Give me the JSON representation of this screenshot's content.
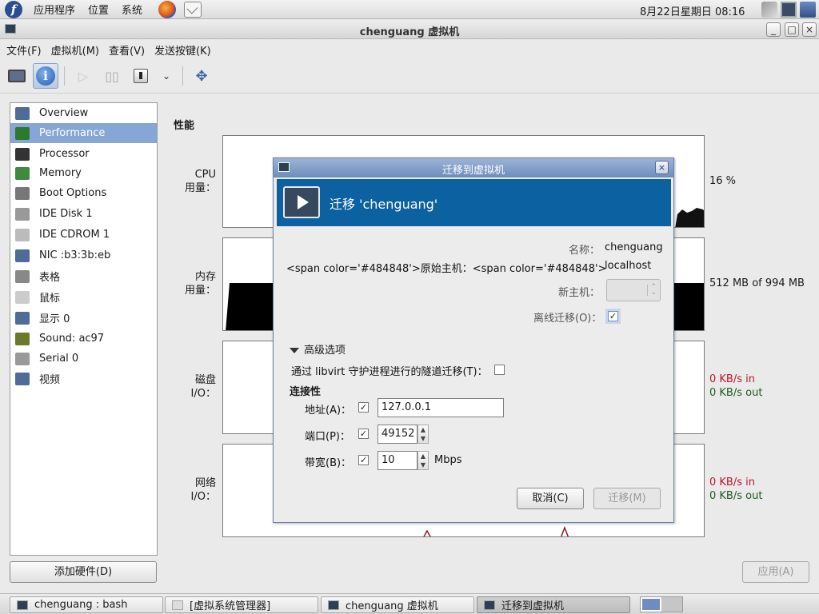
{
  "top_panel": {
    "menus": [
      "应用程序",
      "位置",
      "系统"
    ],
    "clock": "8月22日星期日 08:16"
  },
  "window": {
    "title": "chenguang 虚拟机",
    "menu": [
      "文件(F)",
      "虚拟机(M)",
      "查看(V)",
      "发送按键(K)"
    ],
    "min": "_",
    "max": "□",
    "close": "×"
  },
  "sidebar": {
    "items": [
      {
        "label": "Overview",
        "icon": "monitor-icon",
        "color": "#4f6b97"
      },
      {
        "label": "Performance",
        "icon": "chart-icon",
        "color": "#2c7a2c"
      },
      {
        "label": "Processor",
        "icon": "chip-icon",
        "color": "#333333"
      },
      {
        "label": "Memory",
        "icon": "memory-icon",
        "color": "#3f8a3f"
      },
      {
        "label": "Boot Options",
        "icon": "gear-icon",
        "color": "#777777"
      },
      {
        "label": "IDE Disk 1",
        "icon": "disk-icon",
        "color": "#999999"
      },
      {
        "label": "IDE CDROM 1",
        "icon": "cdrom-icon",
        "color": "#bbbbbb"
      },
      {
        "label": "NIC :b3:3b:eb",
        "icon": "network-icon",
        "color": "#4f6b97"
      },
      {
        "label": "表格",
        "icon": "tablet-icon",
        "color": "#888888"
      },
      {
        "label": "鼠标",
        "icon": "mouse-icon",
        "color": "#cccccc"
      },
      {
        "label": "显示 0",
        "icon": "display-icon",
        "color": "#4f6b97"
      },
      {
        "label": "Sound: ac97",
        "icon": "sound-icon",
        "color": "#6a7a2a"
      },
      {
        "label": "Serial 0",
        "icon": "serial-icon",
        "color": "#999999"
      },
      {
        "label": "视频",
        "icon": "video-icon",
        "color": "#4f6b97"
      }
    ],
    "add_hardware": "添加硬件(D)"
  },
  "performance": {
    "title": "性能",
    "cpu": {
      "label1": "CPU",
      "label2": "用量：",
      "value": "16 %"
    },
    "memory": {
      "label1": "内存",
      "label2": "用量：",
      "value": "512 MB of 994 MB"
    },
    "disk": {
      "label1": "磁盘",
      "label2": "I/O：",
      "in": "0 KB/s in",
      "out": "0 KB/s out"
    },
    "network": {
      "label1": "网络",
      "label2": "I/O：",
      "in": "0 KB/s in",
      "out": "0 KB/s out"
    },
    "apply": "应用(A)"
  },
  "dialog": {
    "title": "迁移到虚拟机",
    "close": "×",
    "banner": "迁移 'chenguang'",
    "name_label": "名称：",
    "name_value": "chenguang",
    "orig_label": "<span color='#484848'>原始主机：<span color='#484848'>",
    "orig_value": "localhost",
    "new_host_label": "新主机：",
    "offline_label": "离线迁移(O)：",
    "offline_checked": "✓",
    "advanced": "高级选项",
    "tunnel_label": "通过 libvirt 守护进程进行的隧道迁移(T)：",
    "connectivity": "连接性",
    "address_label": "地址(A)：",
    "address_checked": "✓",
    "address_value": "127.0.0.1",
    "port_label": "端口(P)：",
    "port_checked": "✓",
    "port_value": "49152",
    "bandwidth_label": "带宽(B)：",
    "bandwidth_checked": "✓",
    "bandwidth_value": "10",
    "bandwidth_unit": "Mbps",
    "cancel": "取消(C)",
    "migrate": "迁移(M)"
  },
  "taskbar": {
    "tasks": [
      {
        "label": "chenguang : bash",
        "icon": "terminal-icon"
      },
      {
        "label": "[虚拟系统管理器]",
        "icon": "vm-manager-icon"
      },
      {
        "label": "chenguang 虚拟机",
        "icon": "vm-icon"
      },
      {
        "label": "迁移到虚拟机",
        "icon": "migrate-icon"
      }
    ]
  }
}
